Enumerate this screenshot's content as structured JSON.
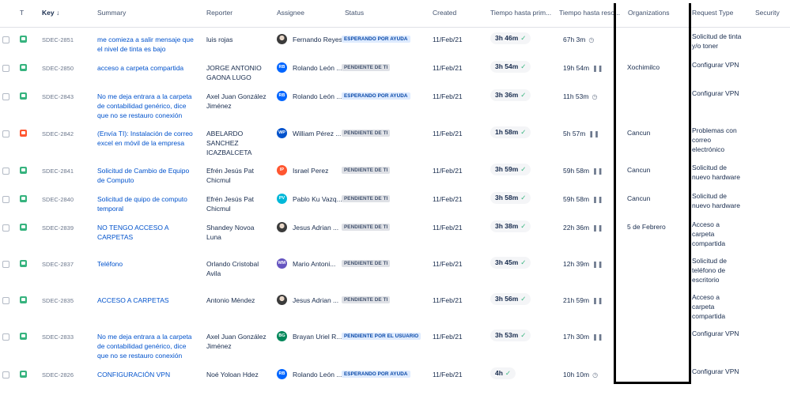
{
  "headers": {
    "t": "T",
    "key": "Key",
    "key_sort_icon": "arrow-down-icon",
    "summary": "Summary",
    "reporter": "Reporter",
    "assignee": "Assignee",
    "status": "Status",
    "created": "Created",
    "sla_first": "Tiempo hasta prim...",
    "sla_resolution": "Tiempo hasta reso...",
    "organizations": "Organizations",
    "request_type": "Request Type",
    "security": "Security"
  },
  "colors": {
    "link": "#0052cc",
    "status_blue_bg": "#deebff",
    "status_grey_bg": "#dfe1e6",
    "check_green": "#36b37e",
    "highlight_box": "#000000"
  },
  "rows": [
    {
      "type_color": "green",
      "key": "SDEC-2851",
      "summary": "me comieza a salir mensaje que el nivel de tinta es bajo",
      "reporter": "luis rojas",
      "avatar": "photo",
      "avatar_color": "#5e6c84",
      "assignee": "Fernando Reyes",
      "status": "ESPERANDO POR AYUDA",
      "status_style": "blue",
      "created": "11/Feb/21",
      "sla_first": "3h 46m",
      "sla_first_icon": "check-icon",
      "sla_res": "67h 3m",
      "sla_res_icon": "clock-icon",
      "org": "",
      "rtype": "Solicitud de tinta y/o toner"
    },
    {
      "type_color": "green",
      "key": "SDEC-2850",
      "summary": "acceso a carpeta compartida",
      "reporter": "JORGE ANTONIO GAONA LUGO",
      "avatar": "RB",
      "avatar_color": "#0065ff",
      "assignee": "Rolando León ...",
      "status": "PENDIENTE DE TI",
      "status_style": "grey",
      "created": "11/Feb/21",
      "sla_first": "3h 54m",
      "sla_first_icon": "check-icon",
      "sla_res": "19h 54m",
      "sla_res_icon": "pause-icon",
      "org": "Xochimilco",
      "rtype": "Configurar VPN"
    },
    {
      "type_color": "green",
      "key": "SDEC-2843",
      "summary": "No me deja entrara a la carpeta de contabilidad genérico, dice que no se restauro conexión",
      "reporter": "Axel Juan González Jiménez",
      "avatar": "RB",
      "avatar_color": "#0065ff",
      "assignee": "Rolando León ...",
      "status": "ESPERANDO POR AYUDA",
      "status_style": "blue",
      "created": "11/Feb/21",
      "sla_first": "3h 36m",
      "sla_first_icon": "check-icon",
      "sla_res": "11h 53m",
      "sla_res_icon": "clock-icon",
      "org": "",
      "rtype": "Configurar VPN"
    },
    {
      "type_color": "red",
      "key": "SDEC-2842",
      "summary": "(Envía TI): Instalación de correo excel en móvil de la empresa",
      "reporter": "ABELARDO SANCHEZ ICAZBALCETA",
      "avatar": "WP",
      "avatar_color": "#0052cc",
      "assignee": "William Pérez ...",
      "status": "PENDIENTE DE TI",
      "status_style": "grey",
      "created": "11/Feb/21",
      "sla_first": "1h 58m",
      "sla_first_icon": "check-icon",
      "sla_res": "5h 57m",
      "sla_res_icon": "pause-icon",
      "org": "Cancun",
      "rtype": "Problemas con correo electrónico"
    },
    {
      "type_color": "green",
      "key": "SDEC-2841",
      "summary": "Solicitud de Cambio de Equipo de Computo",
      "reporter": "Efrén Jesús Pat Chicmul",
      "avatar": "IP",
      "avatar_color": "#ff5630",
      "assignee": "Israel Perez",
      "status": "PENDIENTE DE TI",
      "status_style": "grey",
      "created": "11/Feb/21",
      "sla_first": "3h 59m",
      "sla_first_icon": "check-icon",
      "sla_res": "59h 58m",
      "sla_res_icon": "pause-icon",
      "org": "Cancun",
      "rtype": "Solicitud de nuevo hardware"
    },
    {
      "type_color": "green",
      "key": "SDEC-2840",
      "summary": "Solicitud de quipo de computo temporal",
      "reporter": "Efrén Jesús Pat Chicmul",
      "avatar": "PV",
      "avatar_color": "#00b8d9",
      "assignee": "Pablo Ku Vazq...",
      "status": "PENDIENTE DE TI",
      "status_style": "grey",
      "created": "11/Feb/21",
      "sla_first": "3h 58m",
      "sla_first_icon": "check-icon",
      "sla_res": "59h 58m",
      "sla_res_icon": "pause-icon",
      "org": "Cancun",
      "rtype": "Solicitud de nuevo hardware"
    },
    {
      "type_color": "green",
      "key": "SDEC-2839",
      "summary": "NO TENGO ACCESO A CARPETAS",
      "reporter": "Shandey Novoa Luna",
      "avatar": "photo",
      "avatar_color": "#6b778c",
      "assignee": "Jesus Adrian ...",
      "status": "PENDIENTE DE TI",
      "status_style": "grey",
      "created": "11/Feb/21",
      "sla_first": "3h 38m",
      "sla_first_icon": "check-icon",
      "sla_res": "22h 36m",
      "sla_res_icon": "pause-icon",
      "org": "5 de Febrero",
      "rtype": "Acceso a carpeta compartida"
    },
    {
      "type_color": "green",
      "key": "SDEC-2837",
      "summary": "Teléfono",
      "reporter": "Orlando Cristobal Avila",
      "avatar": "MM",
      "avatar_color": "#6554c0",
      "assignee": "Mario Antoni...",
      "status": "PENDIENTE DE TI",
      "status_style": "grey",
      "created": "11/Feb/21",
      "sla_first": "3h 45m",
      "sla_first_icon": "check-icon",
      "sla_res": "12h 39m",
      "sla_res_icon": "pause-icon",
      "org": "",
      "rtype": "Solicitud de teléfono de escritorio"
    },
    {
      "type_color": "green",
      "key": "SDEC-2835",
      "summary": "ACCESO A CARPETAS",
      "reporter": "Antonio Méndez",
      "avatar": "photo",
      "avatar_color": "#6b778c",
      "assignee": "Jesus Adrian ...",
      "status": "PENDIENTE DE TI",
      "status_style": "grey",
      "created": "11/Feb/21",
      "sla_first": "3h 56m",
      "sla_first_icon": "check-icon",
      "sla_res": "21h 59m",
      "sla_res_icon": "pause-icon",
      "org": "",
      "rtype": "Acceso a carpeta compartida"
    },
    {
      "type_color": "green",
      "key": "SDEC-2833",
      "summary": "No me deja entrara a la carpeta de contabilidad genérico, dice que no se restauro conexión",
      "reporter": "Axel Juan González Jiménez",
      "avatar": "BG",
      "avatar_color": "#00875a",
      "assignee": "Brayan Uriel R...",
      "status": "PENDIENTE POR EL USUARIO",
      "status_style": "blue",
      "created": "11/Feb/21",
      "sla_first": "3h 53m",
      "sla_first_icon": "check-icon",
      "sla_res": "17h 30m",
      "sla_res_icon": "pause-icon",
      "org": "",
      "rtype": "Configurar VPN"
    },
    {
      "type_color": "green",
      "key": "SDEC-2826",
      "summary": "CONFIGURACIÓN VPN",
      "reporter": "Noé Yoloan Hdez",
      "avatar": "RB",
      "avatar_color": "#0065ff",
      "assignee": "Rolando León ...",
      "status": "ESPERANDO POR AYUDA",
      "status_style": "blue",
      "created": "11/Feb/21",
      "sla_first": "4h",
      "sla_first_icon": "check-icon",
      "sla_res": "10h 10m",
      "sla_res_icon": "clock-icon",
      "org": "",
      "rtype": "Configurar VPN"
    }
  ]
}
